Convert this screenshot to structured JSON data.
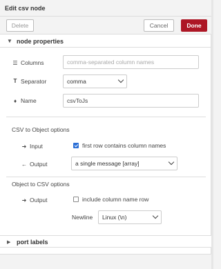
{
  "title": "Edit csv node",
  "buttons": {
    "delete": "Delete",
    "cancel": "Cancel",
    "done": "Done"
  },
  "sections": {
    "node_properties": "node properties",
    "port_labels": "port labels"
  },
  "fields": {
    "columns": {
      "label": "Columns",
      "placeholder": "comma-separated column names",
      "value": ""
    },
    "separator": {
      "label": "Separator",
      "value": "comma"
    },
    "name": {
      "label": "Name",
      "value": "csvToJs"
    }
  },
  "csv_to_object": {
    "title": "CSV to Object options",
    "input_label": "Input",
    "first_row_label": "first row contains column names",
    "first_row_checked": true,
    "output_label": "Output",
    "output_value": "a single message [array]"
  },
  "object_to_csv": {
    "title": "Object to CSV options",
    "output_label": "Output",
    "include_header_label": "include column name row",
    "include_header_checked": false,
    "newline_label": "Newline",
    "newline_value": "Linux (\\n)"
  },
  "icons": {
    "columns": "list-icon",
    "separator": "text-cursor-icon",
    "name": "tag-icon",
    "input": "sign-in-icon",
    "output": "sign-out-icon"
  }
}
